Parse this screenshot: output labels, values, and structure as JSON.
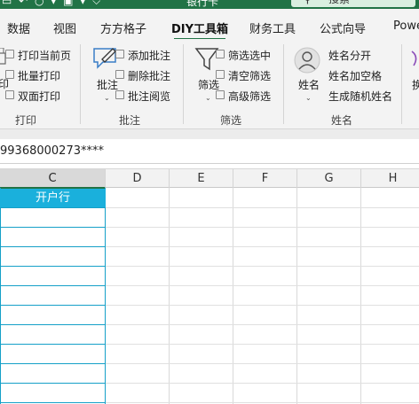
{
  "titlebar": {
    "file_name": "银行卡",
    "search_label": "搜索",
    "accent_color": "#217346"
  },
  "tabs": [
    {
      "label": "数据"
    },
    {
      "label": "视图"
    },
    {
      "label": "方方格子"
    },
    {
      "label": "DIY工具箱",
      "active": true
    },
    {
      "label": "财务工具"
    },
    {
      "label": "公式向导"
    },
    {
      "label": "Powe"
    }
  ],
  "ribbon": {
    "print_group": {
      "items": [
        "打印当前页",
        "批量打印",
        "双面打印"
      ],
      "partial_big_label": "印",
      "group_label": "打印"
    },
    "comment_group": {
      "big_label": "批注",
      "items": [
        "添加批注",
        "删除批注",
        "批注阅览"
      ],
      "group_label": "批注"
    },
    "filter_group": {
      "big_label": "筛选",
      "items": [
        "筛选选中",
        "清空筛选",
        "高级筛选"
      ],
      "group_label": "筛选"
    },
    "name_group": {
      "big_label": "姓名",
      "items": [
        "姓名分开",
        "姓名加空格",
        "生成随机姓名"
      ],
      "group_label": "姓名"
    },
    "partial_next_label": "换"
  },
  "formula_bar": {
    "value": "99368000273****"
  },
  "sheet": {
    "columns": [
      "C",
      "D",
      "E",
      "F",
      "G",
      "H"
    ],
    "selected_column": "C",
    "c_header_cell": "开户行",
    "highlight_color": "#1ab0dc"
  }
}
